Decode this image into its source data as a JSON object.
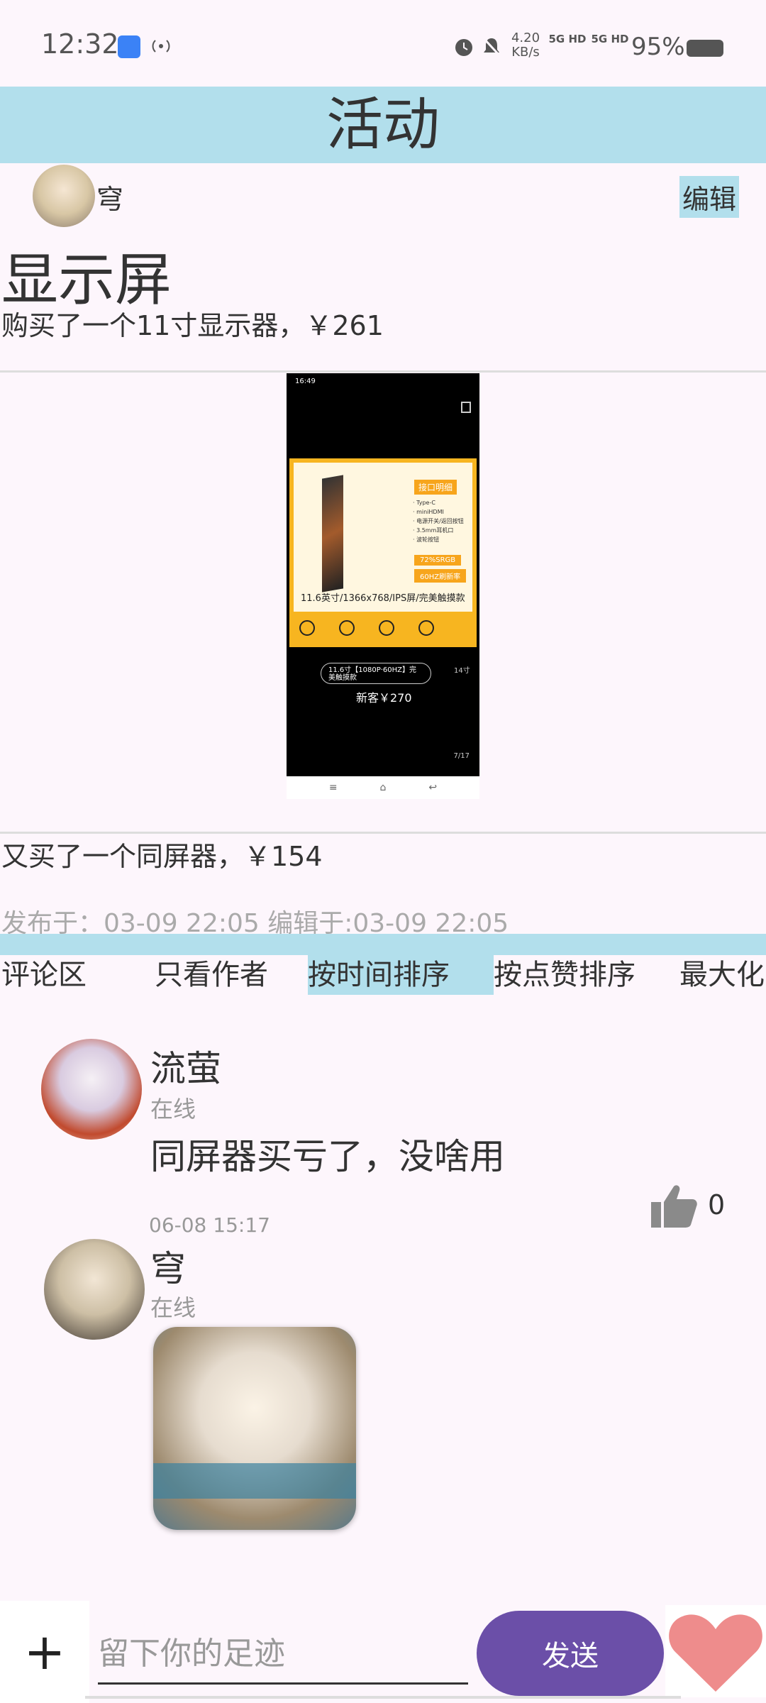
{
  "status_bar": {
    "time": "12:32",
    "net_speed_value": "4.20",
    "net_speed_unit": "KB/s",
    "signal1": "5G HD",
    "signal2": "5G HD",
    "battery": "95%"
  },
  "header": {
    "title": "活动"
  },
  "post": {
    "author": "穹",
    "edit_label": "编辑",
    "title": "显示屏",
    "text1": "购买了一个11寸显示器，￥261",
    "text2": "又买了一个同屏器，￥154",
    "meta": "发布于：03-09 22:05  编辑于:03-09 22:05"
  },
  "image_content": {
    "status": "16:49",
    "tag": "接口明细",
    "specs": [
      "· Type-C",
      "· miniHDMI",
      "· 电源开关/返回按钮",
      "· 3.5mm耳机口",
      "· 波轮按钮"
    ],
    "badge1": "72%SRGB",
    "badge2": "60HZ刷新率",
    "caption": "11.6英寸/1366x768/IPS屏/完美触摸款",
    "option": "11.6寸【1080P·60HZ】完美触摸款",
    "side_option": "14寸",
    "price": "新客￥270",
    "pager": "7/17",
    "nav": [
      "≡",
      "⌂",
      "↩"
    ]
  },
  "tabs": {
    "comments": "评论区",
    "author_only": "只看作者",
    "by_time": "按时间排序",
    "by_likes": "按点赞排序",
    "maximize": "最大化"
  },
  "comments": [
    {
      "name": "流萤",
      "status": "在线",
      "text": "同屏器买亏了，没啥用",
      "likes": "0",
      "time": "06-08 15:17"
    },
    {
      "name": "穹",
      "status": "在线"
    }
  ],
  "bottom": {
    "plus": "+",
    "placeholder": "留下你的足迹",
    "send": "发送"
  }
}
